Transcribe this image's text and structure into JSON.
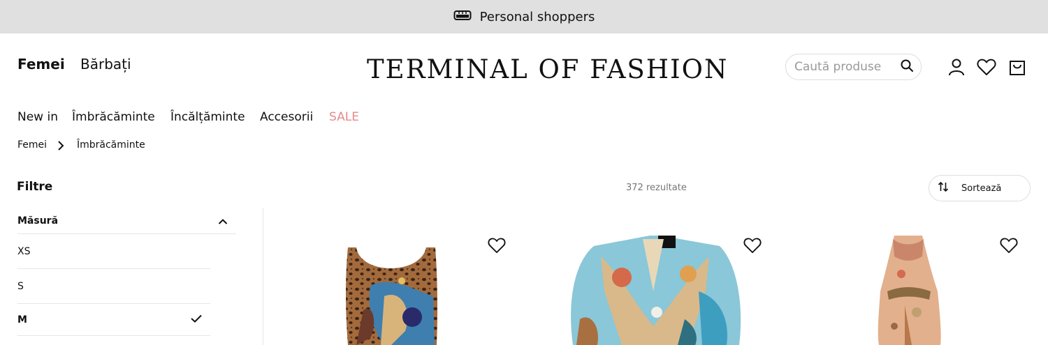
{
  "promo": {
    "text": "Personal shoppers",
    "icon": "tape-measure-icon"
  },
  "header": {
    "genders": [
      {
        "label": "Femei",
        "active": true
      },
      {
        "label": "Bărbați",
        "active": false
      }
    ],
    "logo": "TERMINAL OF FASHION",
    "search": {
      "placeholder": "Caută produse",
      "icon": "search-icon"
    },
    "icons": [
      "user-icon",
      "heart-icon",
      "bag-icon"
    ]
  },
  "categories": [
    {
      "label": "New in"
    },
    {
      "label": "Îmbrăcăminte"
    },
    {
      "label": "Încălțăminte"
    },
    {
      "label": "Accesorii"
    },
    {
      "label": "SALE",
      "color": "#e5898b"
    }
  ],
  "breadcrumb": [
    "Femei",
    "Îmbrăcăminte"
  ],
  "filters": {
    "title": "Filtre",
    "size": {
      "title": "Măsură",
      "expanded": true,
      "options": [
        {
          "label": "XS",
          "selected": false
        },
        {
          "label": "S",
          "selected": false
        },
        {
          "label": "M",
          "selected": true
        }
      ]
    }
  },
  "results": {
    "count_text": "372 rezultate"
  },
  "sort": {
    "label": "Sortează",
    "icon": "sort-arrows-icon"
  },
  "products": [
    {
      "name": "patterned-tank-top",
      "favorite_icon": "heart-icon"
    },
    {
      "name": "printed-silk-wrap-dress",
      "favorite_icon": "heart-icon"
    },
    {
      "name": "printed-halter-dress",
      "favorite_icon": "heart-icon"
    }
  ]
}
